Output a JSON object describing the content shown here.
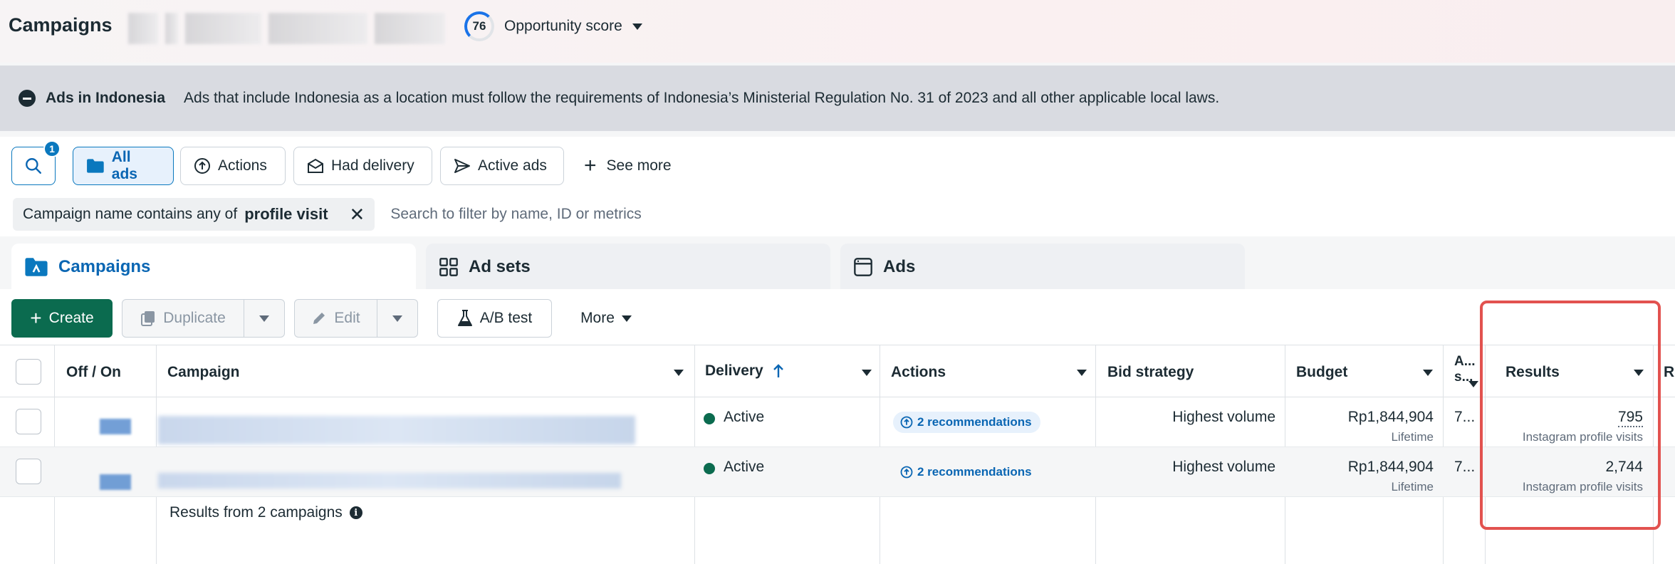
{
  "header": {
    "title": "Campaigns",
    "score_value": "76",
    "score_label": "Opportunity score"
  },
  "banner": {
    "title": "Ads in Indonesia",
    "text": "Ads that include Indonesia as a location must follow the requirements of Indonesia’s Ministerial Regulation No. 31 of 2023 and all other applicable local laws."
  },
  "filters": {
    "search_badge": "1",
    "buttons": [
      "All ads",
      "Actions",
      "Had delivery",
      "Active ads"
    ],
    "see_more": "See more",
    "chip_prefix": "Campaign name contains any of",
    "chip_value": "profile visit",
    "placeholder": "Search to filter by name, ID or metrics"
  },
  "tabs": [
    "Campaigns",
    "Ad sets",
    "Ads"
  ],
  "toolbar": {
    "create": "Create",
    "duplicate": "Duplicate",
    "edit": "Edit",
    "ab_test": "A/B test",
    "more": "More"
  },
  "table": {
    "headers": {
      "off_on": "Off / On",
      "campaign": "Campaign",
      "delivery": "Delivery",
      "actions": "Actions",
      "bid_strategy": "Bid strategy",
      "budget": "Budget",
      "attribution_1": "A...",
      "attribution_2": "s...",
      "results": "Results",
      "next": "R"
    },
    "rows": [
      {
        "delivery": "Active",
        "actions": "2 recommendations",
        "bid_strategy": "Highest volume",
        "budget": "Rp1,844,904",
        "budget_type": "Lifetime",
        "attribution": "7...",
        "results": "795",
        "results_type": "Instagram profile visits"
      },
      {
        "delivery": "Active",
        "actions": "2 recommendations",
        "bid_strategy": "Highest volume",
        "budget": "Rp1,844,904",
        "budget_type": "Lifetime",
        "attribution": "7...",
        "results": "2,744",
        "results_type": "Instagram profile visits"
      }
    ],
    "summary": "Results from 2 campaigns"
  },
  "colors": {
    "accent_blue": "#0a66b3",
    "create_green": "#0b6b4f",
    "highlight_red": "#e2524f",
    "banner_bg": "#d9dbe1"
  }
}
